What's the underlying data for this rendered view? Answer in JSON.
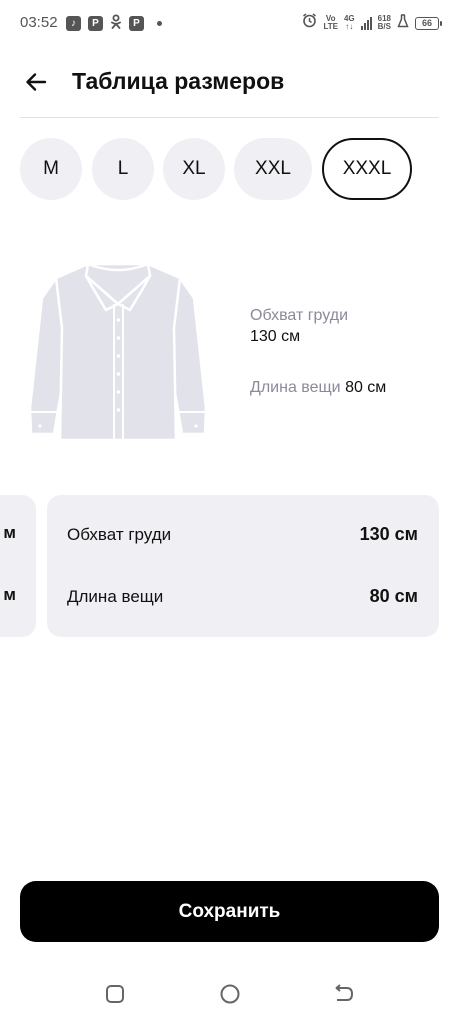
{
  "status_bar": {
    "time": "03:52",
    "left_icons": [
      "music-app-icon",
      "parking-app-icon",
      "odnoklassniki-icon",
      "parking-app-icon"
    ],
    "volte": [
      "Vo",
      "LTE"
    ],
    "network": [
      "4G",
      "↑↓"
    ],
    "speed": [
      "618",
      "B/S"
    ],
    "battery": "66"
  },
  "header": {
    "title": "Таблица размеров"
  },
  "sizes": {
    "items": [
      "M",
      "L",
      "XL",
      "XXL",
      "XXXL"
    ],
    "selected": "XXXL"
  },
  "illustration": {
    "chest_label": "Обхват груди",
    "chest_value": "130 см",
    "length_label": "Длина вещи",
    "length_value": "80 см"
  },
  "partial_card": {
    "row1_tail": "м",
    "row2_tail": "м"
  },
  "card": {
    "rows": [
      {
        "label": "Обхват груди",
        "value": "130 см"
      },
      {
        "label": "Длина вещи",
        "value": "80 см"
      }
    ]
  },
  "actions": {
    "save_label": "Сохранить"
  },
  "nav": {
    "icons": [
      "recent-apps-icon",
      "home-icon",
      "back-icon"
    ]
  },
  "colors": {
    "accent": "#000000",
    "chip_background": "#f0f0f4",
    "muted_text": "#8a8a9c"
  }
}
